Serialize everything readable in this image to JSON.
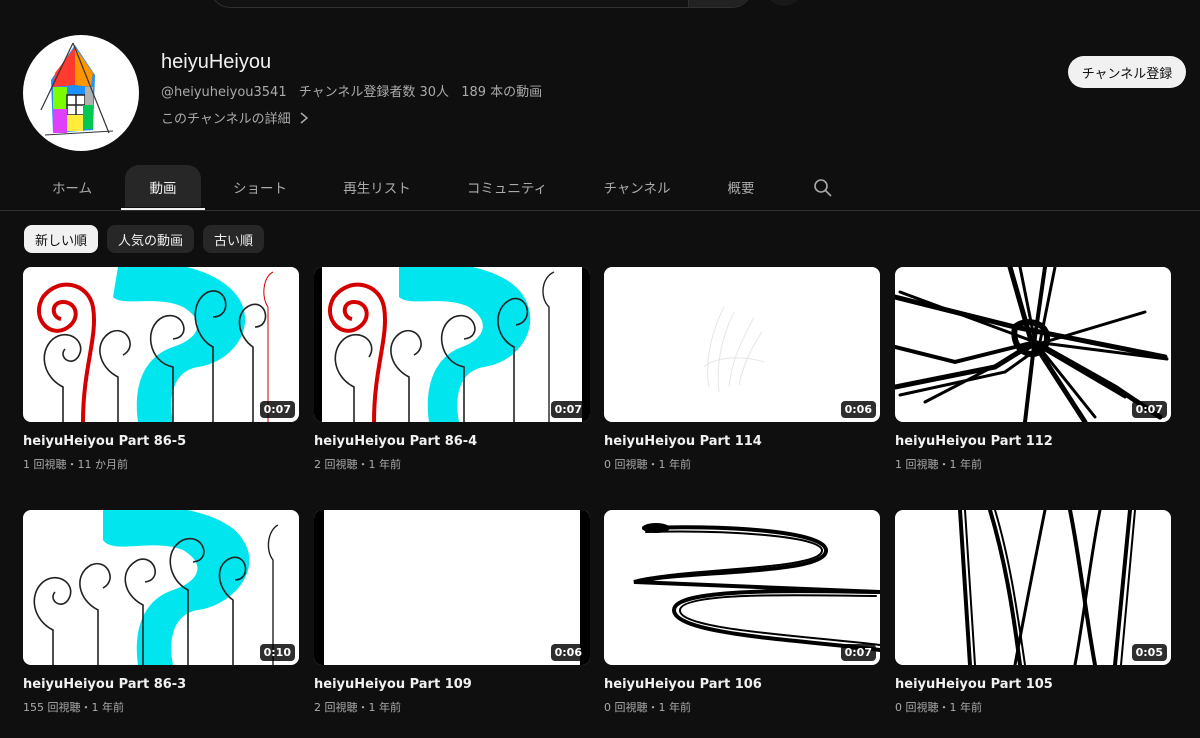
{
  "channel": {
    "name": "heiyuHeiyou",
    "handle": "@heiyuheiyou3541",
    "subscribers": "チャンネル登録者数 30人",
    "video_count": "189 本の動画",
    "about_link": "このチャンネルの詳細",
    "subscribe_label": "チャンネル登録"
  },
  "tabs": [
    {
      "label": "ホーム"
    },
    {
      "label": "動画",
      "active": true
    },
    {
      "label": "ショート"
    },
    {
      "label": "再生リスト"
    },
    {
      "label": "コミュニティ"
    },
    {
      "label": "チャンネル"
    },
    {
      "label": "概要"
    }
  ],
  "chips": [
    {
      "label": "新しい順",
      "selected": true
    },
    {
      "label": "人気の動画"
    },
    {
      "label": "古い順"
    }
  ],
  "videos": [
    {
      "title": "heiyuHeiyou Part 86-5",
      "duration": "0:07",
      "meta": "1 回視聴・11 か月前"
    },
    {
      "title": "heiyuHeiyou Part 86-4",
      "duration": "0:07",
      "meta": "2 回視聴・1 年前"
    },
    {
      "title": "heiyuHeiyou Part 114",
      "duration": "0:06",
      "meta": "0 回視聴・1 年前"
    },
    {
      "title": "heiyuHeiyou Part 112",
      "duration": "0:07",
      "meta": "1 回視聴・1 年前"
    },
    {
      "title": "heiyuHeiyou Part 86-3",
      "duration": "0:10",
      "meta": "155 回視聴・1 年前"
    },
    {
      "title": "heiyuHeiyou Part 109",
      "duration": "0:06",
      "meta": "2 回視聴・1 年前"
    },
    {
      "title": "heiyuHeiyou Part 106",
      "duration": "0:07",
      "meta": "0 回視聴・1 年前"
    },
    {
      "title": "heiyuHeiyou Part 105",
      "duration": "0:05",
      "meta": "0 回視聴・1 年前"
    }
  ],
  "colors": {
    "background": "#0f0f0f",
    "text_primary": "#f1f1f1",
    "text_secondary": "#aaaaaa",
    "chip_bg": "#272727",
    "accent_cyan": "#00e5ee",
    "accent_red": "#d40000"
  }
}
